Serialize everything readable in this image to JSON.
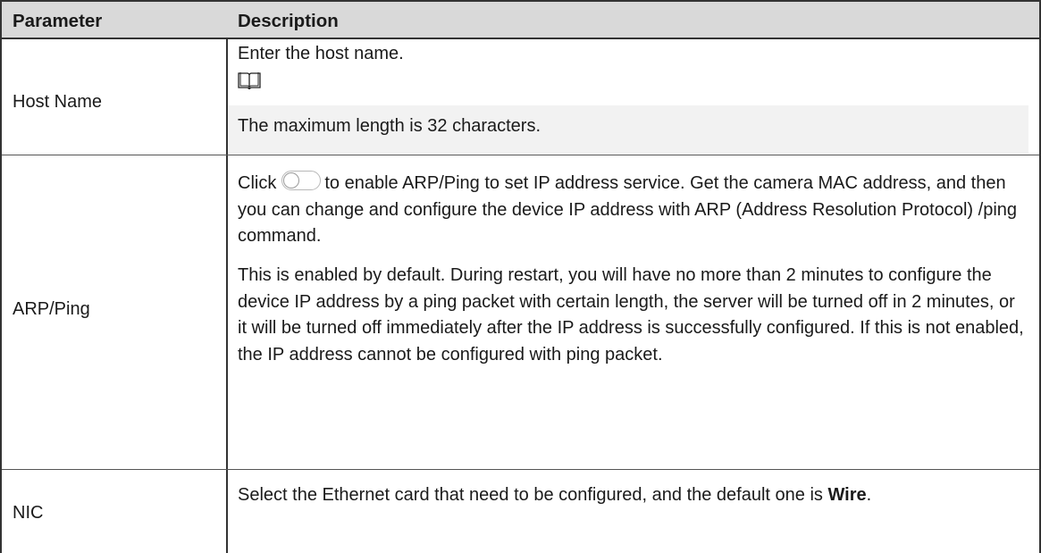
{
  "table": {
    "header": {
      "parameter": "Parameter",
      "description": "Description"
    },
    "rows": {
      "host_name": {
        "parameter": "Host Name",
        "description": "Enter the host name.",
        "note_icon": "book-icon",
        "note": "The maximum length is 32 characters."
      },
      "arp_ping": {
        "parameter": "ARP/Ping",
        "para1_before_icon": "Click",
        "para1_icon": "toggle-switch-icon",
        "para1_after_icon": "to enable ARP/Ping to set IP address service. Get the camera MAC address, and then you can change and configure the device IP address with ARP (Address Resolution Protocol) /ping command.",
        "para2": "This is enabled by default. During restart, you will have no more than 2 minutes to configure the device IP address by a ping packet with certain length, the server will be turned off in 2 minutes, or it will be turned off immediately after the IP address is successfully configured. If this is not enabled, the IP address cannot be configured with ping packet."
      },
      "nic": {
        "parameter": "NIC",
        "description_text": "Select the Ethernet card that need to be configured, and the default one is",
        "description_bold": "Wire",
        "description_end": "."
      }
    }
  },
  "colors": {
    "header_bg": "#d9d9d9",
    "note_bg": "#f2f2f2",
    "border": "#333333"
  }
}
